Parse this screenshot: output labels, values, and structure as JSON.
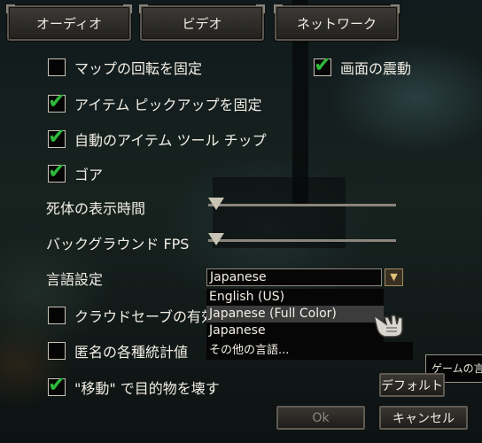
{
  "tabs": {
    "audio": "オーディオ",
    "video": "ビデオ",
    "network": "ネットワーク"
  },
  "options": {
    "lock_map_rotation": {
      "label": "マップの回転を固定",
      "checked": false
    },
    "screen_shake": {
      "label": "画面の震動",
      "checked": true
    },
    "lock_item_pickup": {
      "label": "アイテム ピックアップを固定",
      "checked": true
    },
    "auto_item_tooltip": {
      "label": "自動のアイテム ツール チップ",
      "checked": true
    },
    "gore": {
      "label": "ゴア",
      "checked": true
    },
    "cloud_save": {
      "label": "クラウドセーブの有効",
      "checked": false
    },
    "anonymous_stats": {
      "label": "匿名の各種統計値",
      "checked": false
    },
    "move_destroys_targets": {
      "label": "\"移動\" で目的物を壊す",
      "checked": true
    }
  },
  "sliders": {
    "corpse_duration": {
      "label": "死体の表示時間",
      "value": 0
    },
    "background_fps": {
      "label": "バックグラウンド FPS",
      "value": 0
    }
  },
  "language": {
    "label": "言語設定",
    "selected": "Japanese",
    "options": [
      "English (US)",
      "Japanese (Full Color)",
      "Japanese"
    ],
    "highlighted": "Japanese (Full Color)",
    "more_label": "その他の言語..."
  },
  "tooltip_text": "ゲームの言",
  "buttons": {
    "default": "デフォルト",
    "ok": "Ok",
    "cancel": "キャンセル"
  },
  "icons": {
    "dropdown": "chevron-down-icon",
    "cursor": "gauntlet-hand-cursor-icon",
    "check": "check-icon"
  },
  "colors": {
    "check": "#2fb83a"
  }
}
